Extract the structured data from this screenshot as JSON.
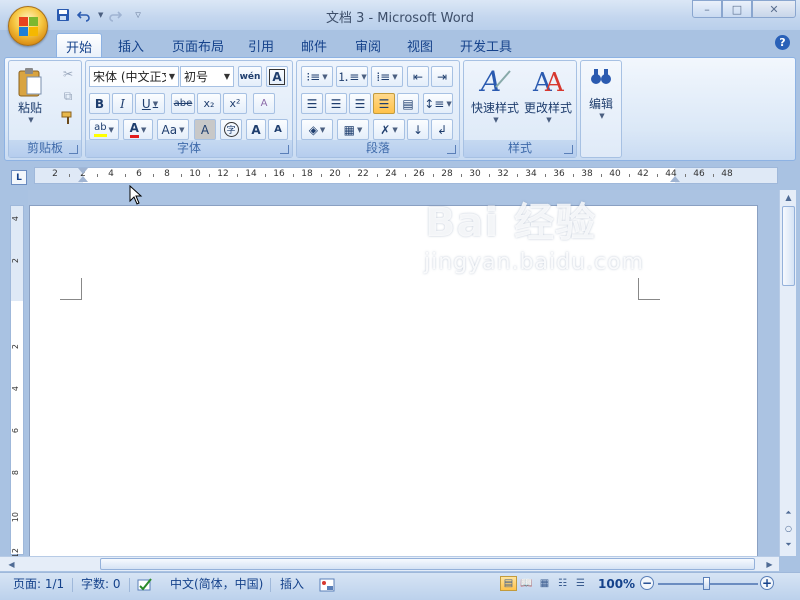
{
  "window": {
    "title": "文档 3 - Microsoft Word",
    "minimize": "–",
    "maximize": "□",
    "close": "✕"
  },
  "quick_access": {
    "save_icon": "save-icon",
    "undo_icon": "undo-icon",
    "redo_icon": "redo-icon"
  },
  "tabs": [
    "开始",
    "插入",
    "页面布局",
    "引用",
    "邮件",
    "审阅",
    "视图",
    "开发工具"
  ],
  "active_tab": "开始",
  "help": "?",
  "ribbon": {
    "clipboard": {
      "label": "剪贴板",
      "paste_label": "粘贴"
    },
    "font": {
      "label": "字体",
      "font_name": "宋体 (中文正文)",
      "font_size": "初号",
      "phonetic_label": "wén",
      "border_label": "A",
      "bold": "B",
      "italic": "I",
      "underline": "U",
      "strike": "abe",
      "subscript": "x₂",
      "superscript": "x²",
      "clear_format": "A",
      "font_color": "A",
      "change_case": "Aa",
      "char_shading": "A",
      "enclose": "字",
      "grow": "A",
      "shrink": "A"
    },
    "paragraph": {
      "label": "段落"
    },
    "styles": {
      "label": "样式",
      "quick_styles": "快速样式",
      "change_styles": "更改样式"
    },
    "editing": {
      "label": "编辑"
    }
  },
  "ruler": {
    "corner": "L",
    "h_numbers": [
      "2",
      "2",
      "4",
      "6",
      "8",
      "10",
      "12",
      "14",
      "16",
      "18",
      "20",
      "22",
      "24",
      "26",
      "28",
      "30",
      "32",
      "34",
      "36",
      "38",
      "40",
      "42",
      "44",
      "46",
      "48"
    ],
    "v_numbers": [
      "4",
      "2",
      "2",
      "4",
      "6",
      "8",
      "10",
      "12"
    ]
  },
  "statusbar": {
    "page": "页面: 1/1",
    "words": "字数: 0",
    "language": "中文(简体，中国)",
    "insert_mode": "插入",
    "zoom": "100%"
  },
  "watermark": {
    "brand": "Bai 经验",
    "url": "jingyan.baidu.com"
  },
  "colors": {
    "accent": "#15428b",
    "ribbon_bg": "#dbe8f7",
    "font_color_red": "#e21c1c",
    "highlight_yellow": "#ffff00"
  }
}
